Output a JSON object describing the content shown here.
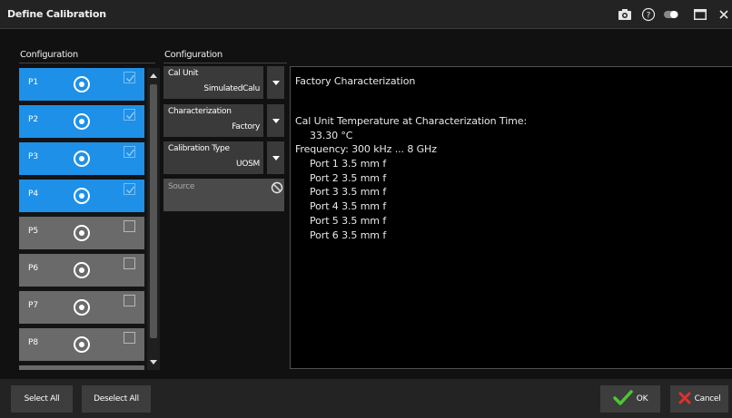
{
  "title": "Define Calibration",
  "toolbar": {
    "icons": [
      "camera-icon",
      "help-icon",
      "toggle-icon",
      "maximize-icon",
      "close-icon"
    ]
  },
  "left_section": {
    "label": "Configuration"
  },
  "ports": [
    {
      "name": "P1",
      "selected": true
    },
    {
      "name": "P2",
      "selected": true
    },
    {
      "name": "P3",
      "selected": true
    },
    {
      "name": "P4",
      "selected": true
    },
    {
      "name": "P5",
      "selected": false
    },
    {
      "name": "P6",
      "selected": false
    },
    {
      "name": "P7",
      "selected": false
    },
    {
      "name": "P8",
      "selected": false
    }
  ],
  "right_section": {
    "label": "Configuration"
  },
  "config": {
    "cal_unit": {
      "label": "Cal Unit",
      "value": "SimulatedCalu"
    },
    "characterization": {
      "label": "Characterization",
      "value": "Factory"
    },
    "calibration_type": {
      "label": "Calibration Type",
      "value": "UOSM"
    },
    "source": {
      "label": "Source"
    }
  },
  "info": {
    "heading": "Factory Characterization",
    "temp_label": "Cal Unit Temperature at Characterization Time:",
    "temp_value": "33.30 °C",
    "frequency": "Frequency: 300 kHz ... 8 GHz",
    "ports": [
      "Port 1 3.5 mm f",
      "Port 2 3.5 mm f",
      "Port 3 3.5 mm f",
      "Port 4 3.5 mm f",
      "Port 5 3.5 mm f",
      "Port 6 3.5 mm f"
    ]
  },
  "footer": {
    "select_all": "Select All",
    "deselect_all": "Deselect All",
    "ok": "OK",
    "cancel": "Cancel"
  },
  "colors": {
    "selected_row": "#1e90e8",
    "unselected_row": "#6a6a6a",
    "ok_check": "#4cc830",
    "cancel_x": "#e03030"
  }
}
